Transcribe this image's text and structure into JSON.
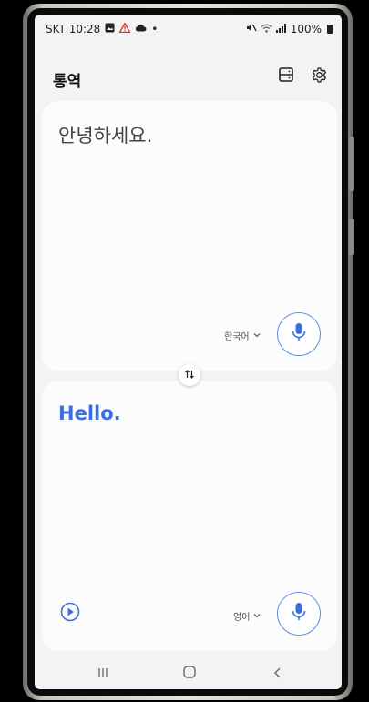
{
  "status_bar": {
    "carrier_time": "SKT 10:28",
    "dot": "•",
    "battery": "100%"
  },
  "header": {
    "title": "통역"
  },
  "source": {
    "text": "안녕하세요.",
    "language": "한국어"
  },
  "target": {
    "text": "Hello.",
    "language": "영어"
  },
  "icons": {
    "status_left": [
      "gallery-icon",
      "warning-icon",
      "cloud-icon"
    ],
    "status_right": [
      "mute-icon",
      "wifi-icon",
      "signal-icon",
      "battery-icon"
    ],
    "header": [
      "split-screen-icon",
      "gear-icon"
    ],
    "swap": "swap-arrows-icon",
    "mic": "microphone-icon",
    "play": "play-icon",
    "nav": [
      "recent-apps-icon",
      "home-icon",
      "back-icon"
    ]
  },
  "colors": {
    "accent": "#3b6ee0",
    "mic_border": "#5b8ee6",
    "background": "#f3f3f6",
    "card": "#fcfcfd"
  }
}
